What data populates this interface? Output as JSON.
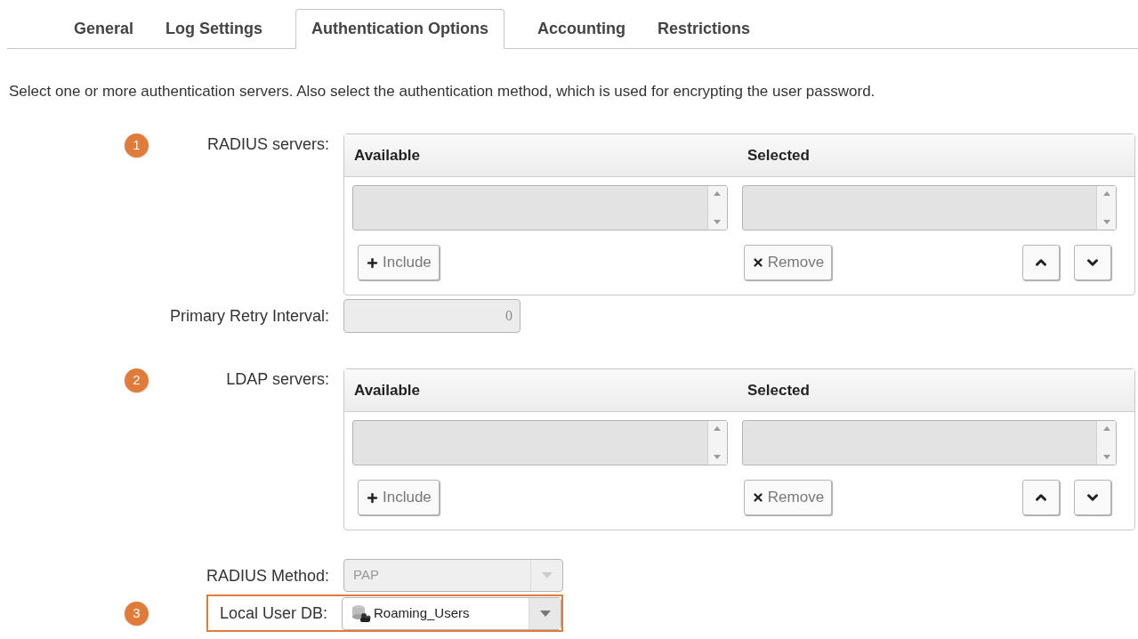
{
  "tabs": [
    {
      "label": "General",
      "selected": false
    },
    {
      "label": "Log Settings",
      "selected": false
    },
    {
      "label": "Authentication Options",
      "selected": true
    },
    {
      "label": "Accounting",
      "selected": false
    },
    {
      "label": "Restrictions",
      "selected": false
    }
  ],
  "description": "Select one or more authentication servers. Also select the authentication method, which is used for encrypting the user password.",
  "rows": [
    {
      "kind": "list_builder",
      "badge": "1",
      "label": "RADIUS servers:",
      "available_header": "Available",
      "selected_header": "Selected",
      "include_button": "Include",
      "remove_button": "Remove"
    },
    {
      "kind": "field",
      "label": "Primary Retry Interval:",
      "value": "0",
      "disabled": true
    },
    {
      "kind": "list_builder",
      "badge": "2",
      "label": "LDAP servers:",
      "available_header": "Available",
      "selected_header": "Selected",
      "include_button": "Include",
      "remove_button": "Remove"
    },
    {
      "kind": "select",
      "label": "RADIUS Method:",
      "value": "PAP",
      "disabled": true,
      "highlighted": false
    },
    {
      "kind": "select",
      "badge": "3",
      "label": "Local User DB:",
      "value": "Roaming_Users",
      "disabled": false,
      "highlighted": true
    }
  ]
}
